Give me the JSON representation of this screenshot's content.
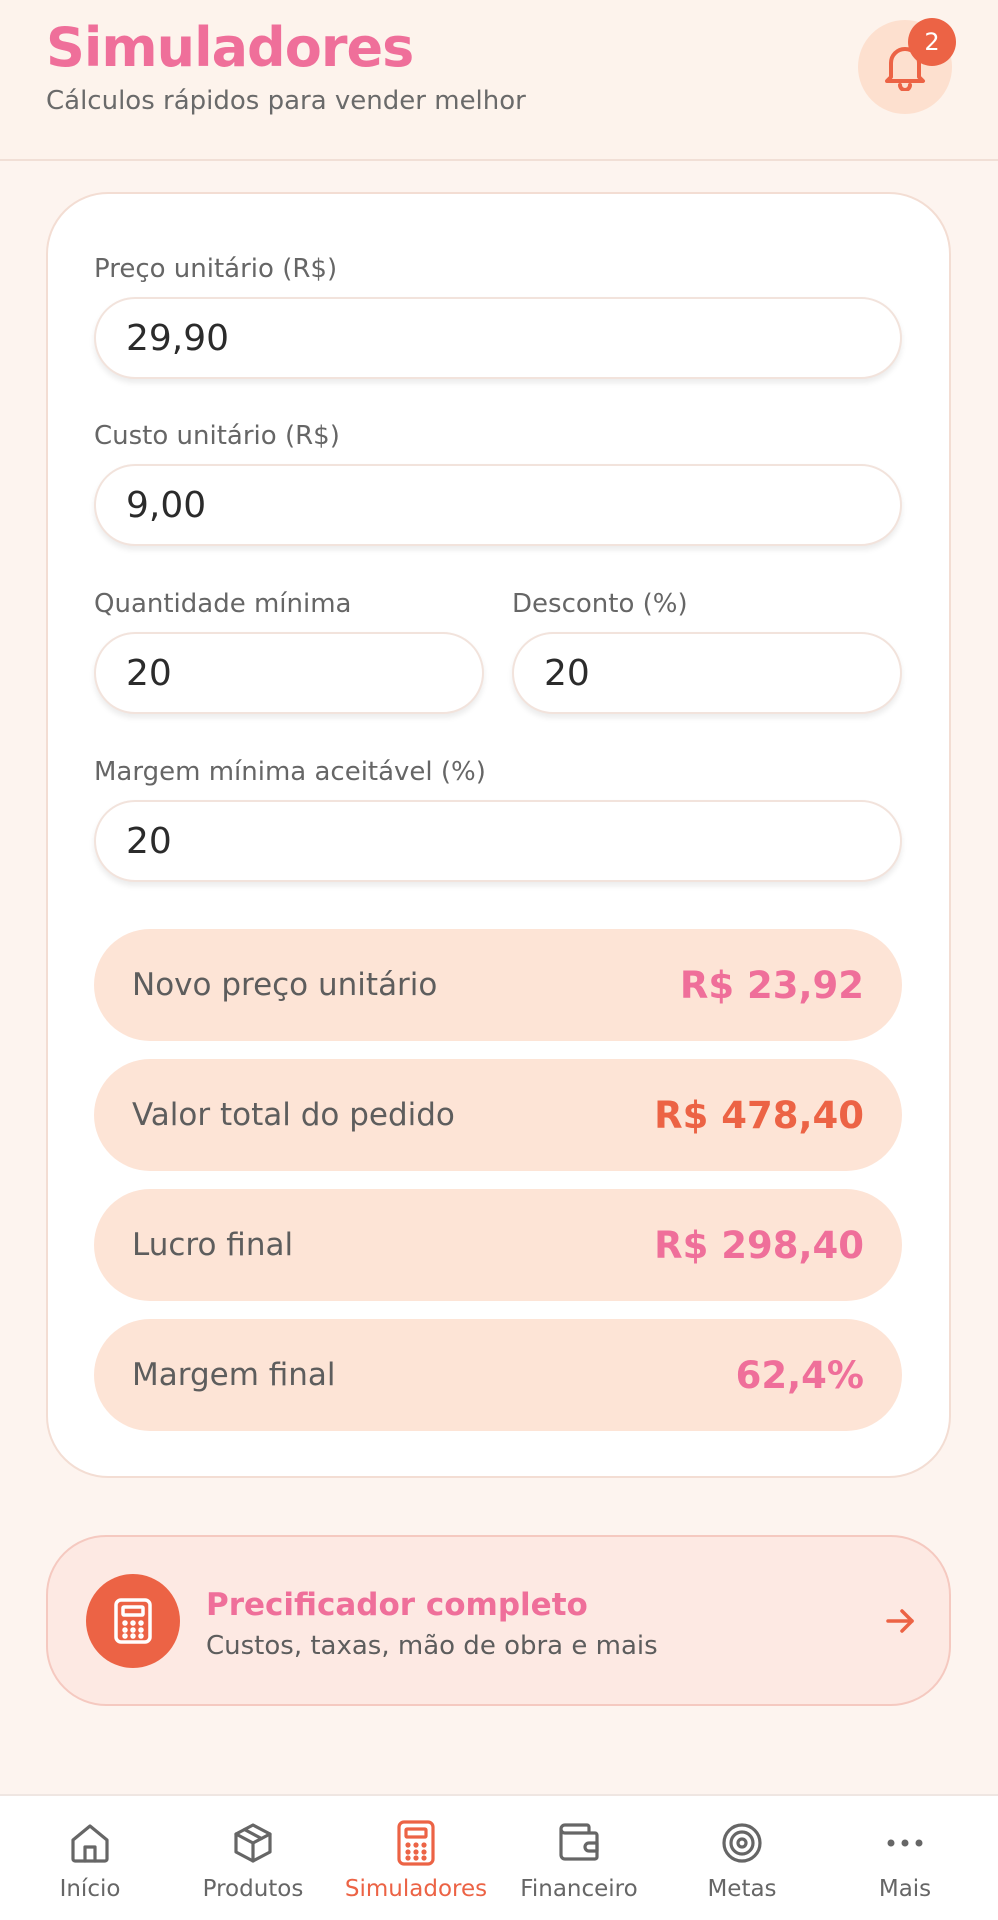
{
  "header": {
    "title": "Simuladores",
    "subtitle": "Cálculos rápidos para vender melhor",
    "notifications_count": "2"
  },
  "form": {
    "unit_price_label": "Preço unitário (R$)",
    "unit_price_value": "29,90",
    "unit_cost_label": "Custo unitário (R$)",
    "unit_cost_value": "9,00",
    "min_qty_label": "Quantidade mínima",
    "min_qty_value": "20",
    "discount_label": "Desconto (%)",
    "discount_value": "20",
    "min_margin_label": "Margem mínima aceitável (%)",
    "min_margin_value": "20"
  },
  "results": [
    {
      "label": "Novo preço unitário",
      "value": "R$ 23,92",
      "color": "#ef6f9a"
    },
    {
      "label": "Valor total do pedido",
      "value": "R$ 478,40",
      "color": "#ec6345"
    },
    {
      "label": "Lucro final",
      "value": "R$ 298,40",
      "color": "#ef6f9a"
    },
    {
      "label": "Margem final",
      "value": "62,4%",
      "color": "#ef6f9a"
    }
  ],
  "promo": {
    "title": "Precificador completo",
    "subtitle": "Custos, taxas, mão de obra e mais",
    "icon": "calculator-icon"
  },
  "nav": {
    "items": [
      {
        "label": "Início",
        "icon": "home-icon"
      },
      {
        "label": "Produtos",
        "icon": "box-icon"
      },
      {
        "label": "Simuladores",
        "icon": "calculator-icon",
        "active": true
      },
      {
        "label": "Financeiro",
        "icon": "wallet-icon"
      },
      {
        "label": "Metas",
        "icon": "target-icon"
      },
      {
        "label": "Mais",
        "icon": "more-icon"
      }
    ]
  },
  "colors": {
    "accent": "#ec6345",
    "brand_pink": "#ef6f9a",
    "result_bg": "#fde4d6",
    "page_bg": "#fdf4ef"
  }
}
